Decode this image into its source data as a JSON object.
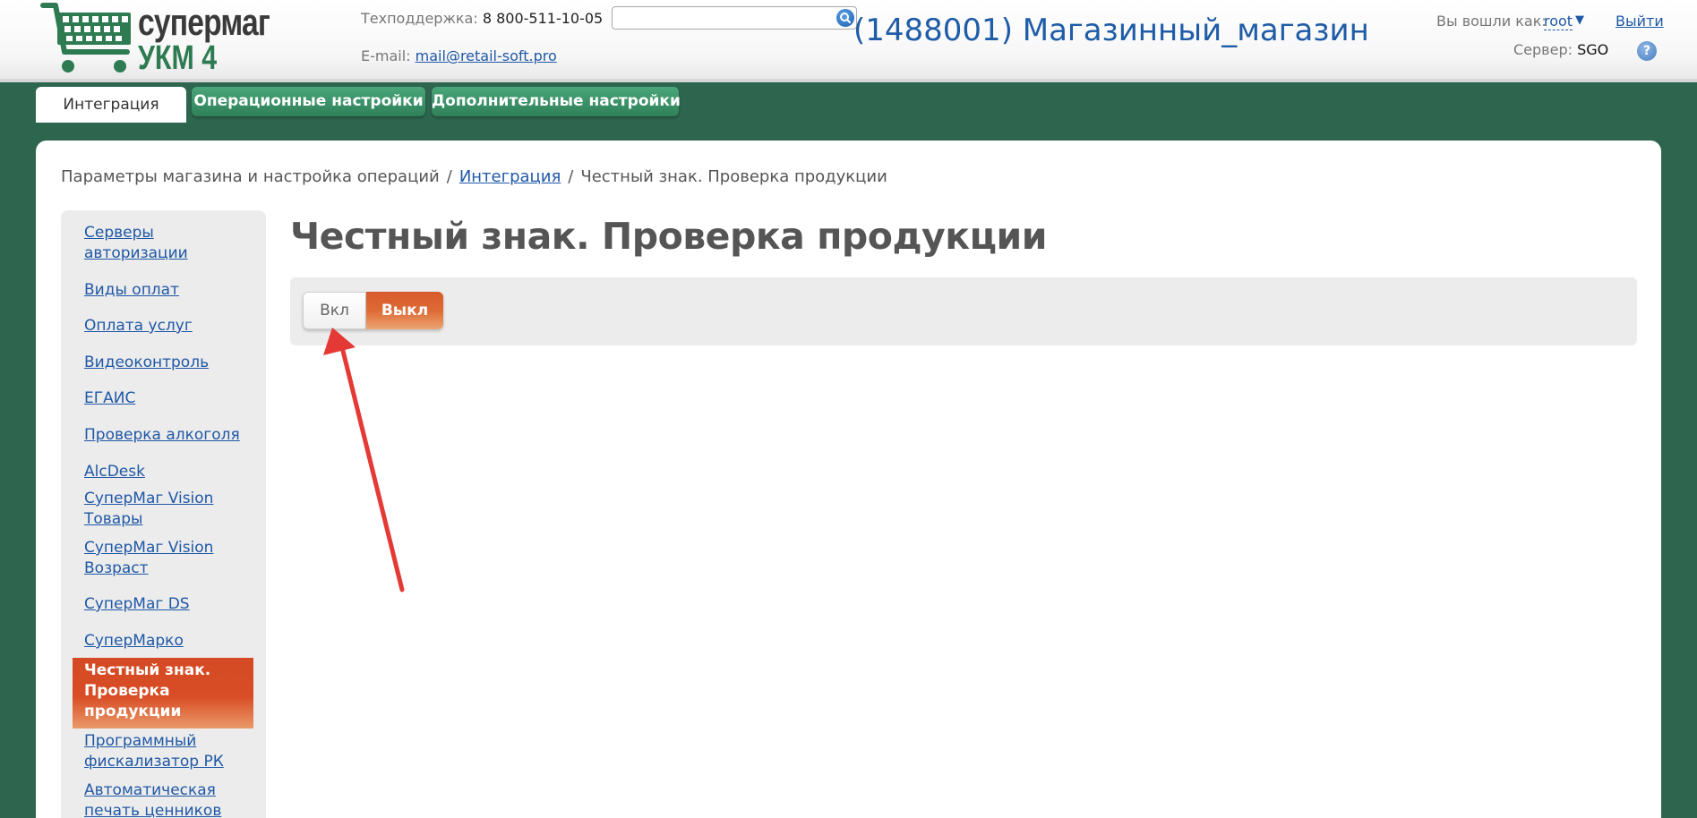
{
  "header": {
    "logo": {
      "line1": "супермаг",
      "line2": "УКМ 4",
      "icon": "shopping-cart-icon"
    },
    "support_label": "Техподдержка:",
    "support_phone": "8 800-511-10-05",
    "email_label": "E-mail:",
    "email": "mail@retail-soft.pro",
    "search": {
      "value": "",
      "placeholder": "",
      "icon": "search-icon"
    },
    "shop_title": "(1488001) Магазинный_магазин",
    "login_label": "Вы вошли как:",
    "login_user": "root",
    "login_arrow": "▼",
    "logout": "Выйти",
    "server_label": "Сервер:",
    "server": "SGO",
    "help": "?"
  },
  "tabs": [
    {
      "label": "Интеграция",
      "active": true
    },
    {
      "label": "Операционные настройки",
      "active": false
    },
    {
      "label": "Дополнительные настройки",
      "active": false
    }
  ],
  "breadcrumb": {
    "root": "Параметры магазина и настройка операций",
    "sep": "/",
    "link": "Интеграция",
    "current": "Честный знак. Проверка продукции"
  },
  "sidebar": {
    "items": [
      {
        "line1": "Серверы",
        "line2": "авторизации"
      },
      {
        "line1": "Виды оплат",
        "line2": ""
      },
      {
        "line1": "Оплата услуг",
        "line2": ""
      },
      {
        "line1": "Видеоконтроль",
        "line2": ""
      },
      {
        "line1": "ЕГАИС",
        "line2": ""
      },
      {
        "line1": "Проверка алкоголя",
        "line2": ""
      },
      {
        "line1": "AlcDesk",
        "line2": ""
      },
      {
        "line1": "СуперМаг Vision",
        "line2": "Товары"
      },
      {
        "line1": "СуперМаг Vision",
        "line2": "Возраст"
      },
      {
        "line1": "СуперМаг DS",
        "line2": ""
      },
      {
        "line1": "СуперМарко",
        "line2": ""
      },
      {
        "line1": "Программный",
        "line2": "фискализатор РК"
      },
      {
        "line1": "Автоматическая",
        "line2": "печать ценников"
      }
    ],
    "active": {
      "line1": "Честный знак.",
      "line2": "Проверка",
      "line3": "продукции"
    }
  },
  "content": {
    "title": "Честный знак. Проверка продукции",
    "toggle_on": "Вкл",
    "toggle_off": "Выкл",
    "selected": "Выкл"
  },
  "colors": {
    "background": "#2d654f",
    "accent_orange": "#d84d25",
    "link_blue": "#1f58a6",
    "tab_green": "#3a936a",
    "annotation_red": "#e53935"
  }
}
